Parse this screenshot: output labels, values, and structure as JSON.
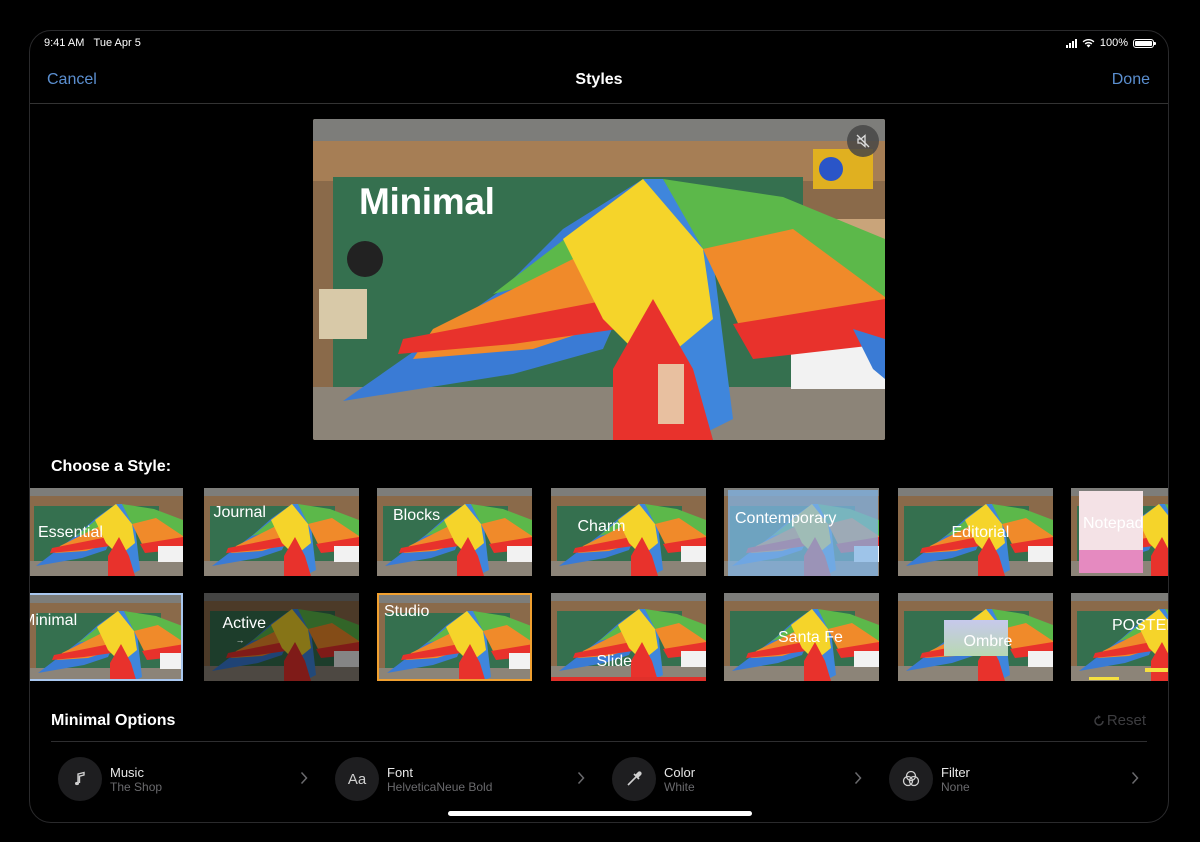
{
  "status": {
    "time": "9:41 AM",
    "date": "Tue Apr 5",
    "battery": "100%"
  },
  "nav": {
    "cancel": "Cancel",
    "title": "Styles",
    "done": "Done"
  },
  "preview": {
    "title": "Minimal",
    "mute_icon": "speaker-mute-icon"
  },
  "choose_label": "Choose a Style:",
  "styles_row1": [
    "Essential",
    "Journal",
    "Blocks",
    "Charm",
    "Contemporary",
    "Editorial",
    "Notepad"
  ],
  "styles_row2": [
    "Minimal",
    "Active",
    "Studio",
    "Slide",
    "Santa Fe",
    "Ombre",
    "POSTER"
  ],
  "selected_style": "Minimal",
  "options_label": "Minimal Options",
  "reset": "Reset",
  "options": [
    {
      "title": "Music",
      "value": "The Shop",
      "icon": "music-note-icon"
    },
    {
      "title": "Font",
      "value": "HelveticaNeue Bold",
      "icon": "font-icon"
    },
    {
      "title": "Color",
      "value": "White",
      "icon": "eyedropper-icon"
    },
    {
      "title": "Filter",
      "value": "None",
      "icon": "filter-circles-icon"
    }
  ],
  "colors": {
    "accent": "#5b8fd0",
    "background": "#000000",
    "selected_border": "#a9c7ef",
    "studio_border": "#f0a030"
  }
}
